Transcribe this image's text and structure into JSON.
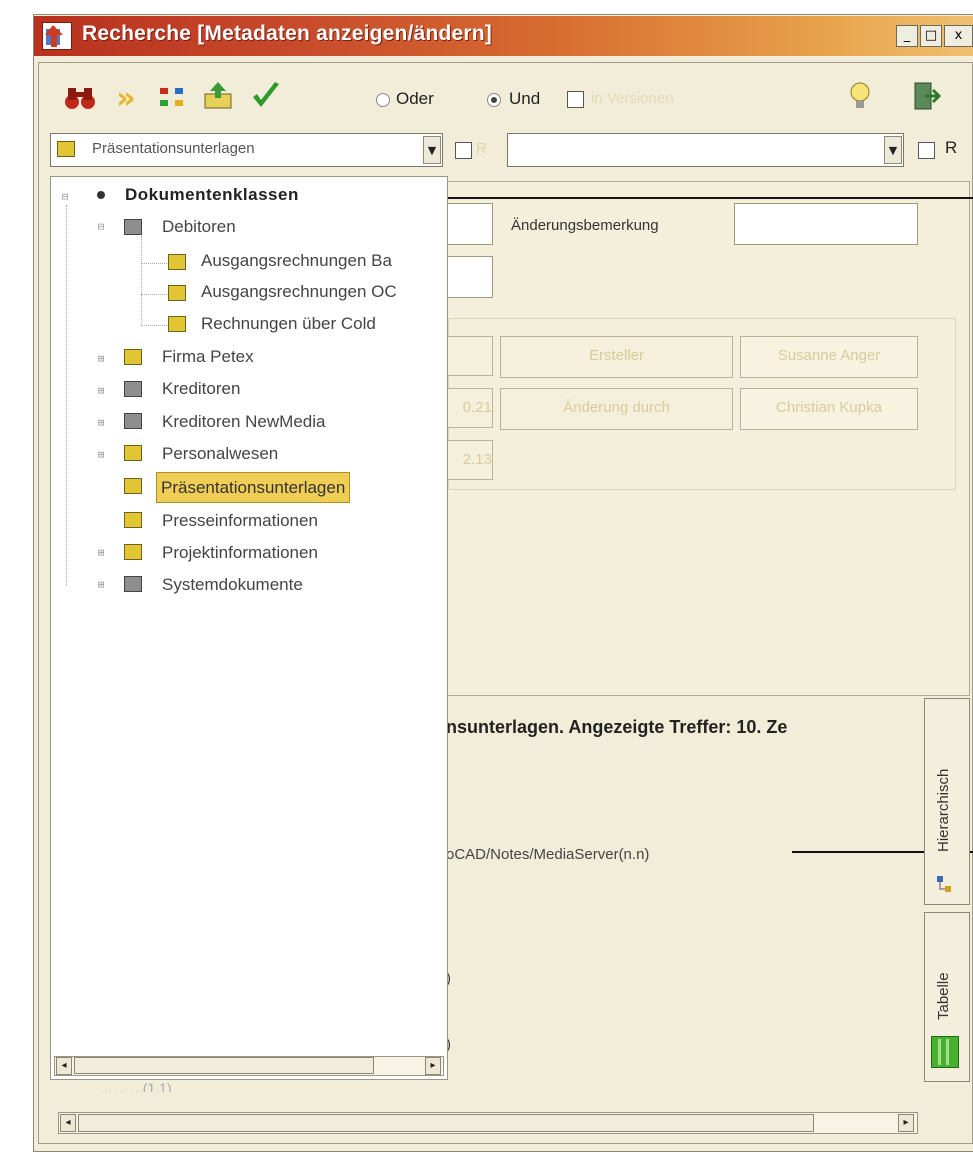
{
  "window": {
    "title": "Recherche [Metadaten anzeigen/ändern]",
    "buttons": {
      "minimize": "_",
      "maximize": "□",
      "close": "x"
    }
  },
  "toolbar": {
    "icons": [
      "binoculars-icon",
      "forward-icon",
      "hierarchy-icon",
      "upload-icon",
      "checkmark-icon",
      "lightbulb-icon",
      "exit-icon"
    ],
    "radio_or": "Oder",
    "radio_and": "Und",
    "radio_selected": "Und",
    "checkbox_versions": "in Versionen"
  },
  "combos": {
    "doc_class_value": "Präsentationsunterlagen",
    "checkbox_r1": "R",
    "second_value": "",
    "checkbox_r2": "R"
  },
  "form": {
    "change_remark_label": "Änderungsbemerkung",
    "change_remark_value": "",
    "creator_label": "Ersteller",
    "creator_value": "Susanne Anger",
    "changed_by_label": "Änderung durch",
    "changed_by_value": "Christian Kupka",
    "partial_field_1": "0.21",
    "partial_field_2": "2.13"
  },
  "tree": {
    "root": "Dokumentenklassen",
    "debitoren": "Debitoren",
    "debitoren_children": [
      "Ausgangsrechnungen Ba",
      "Ausgangsrechnungen OC",
      "Rechnungen über Cold"
    ],
    "items": [
      "Firma Petex",
      "Kreditoren",
      "Kreditoren NewMedia",
      "Personalwesen",
      "Präsentationsunterlagen",
      "Presseinformationen",
      "Projektinformationen",
      "Systemdokumente"
    ],
    "selected": "Präsentationsunterlagen"
  },
  "results": {
    "header_fragment": "nsunterlagen. Angezeigte Treffer: 10. Ze",
    "path_fragment": "oCAD/Notes/MediaServer(n.n)",
    "bracket_1": ")",
    "bracket_2": ")",
    "hidden_row": "... ... ...(1.1)"
  },
  "side_tabs": {
    "hierarchical": "Hierarchisch",
    "table": "Tabelle"
  }
}
